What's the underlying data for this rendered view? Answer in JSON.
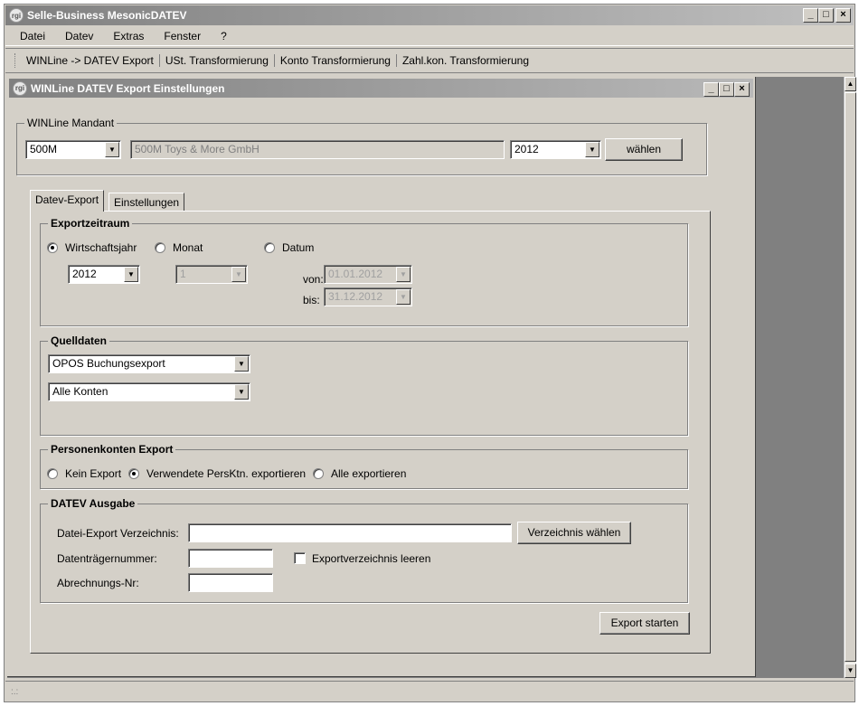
{
  "app": {
    "title": "Selle-Business MesonicDATEV",
    "icon_text": "rgi",
    "controls": {
      "minimize": "_",
      "maximize": "□",
      "close": "×"
    }
  },
  "menu": [
    "Datei",
    "Datev",
    "Extras",
    "Fenster",
    "?"
  ],
  "toolbar": [
    "WINLine -> DATEV Export",
    "USt. Transformierung",
    "Konto Transformierung",
    "Zahl.kon. Transformierung"
  ],
  "dialog": {
    "title": "WINLine DATEV Export Einstellungen",
    "mandant": {
      "legend": "WINLine Mandant",
      "code": "500M",
      "name": "500M Toys & More GmbH",
      "year": "2012",
      "select_button": "wählen"
    },
    "tabs": [
      "Datev-Export",
      "Einstellungen"
    ],
    "exportzeitraum": {
      "legend": "Exportzeitraum",
      "radio_wirtschaftsjahr": "Wirtschaftsjahr",
      "radio_monat": "Monat",
      "radio_datum": "Datum",
      "year": "2012",
      "month": "1",
      "von_label": "von:",
      "bis_label": "bis:",
      "von": "01.01.2012",
      "bis": "31.12.2012"
    },
    "quelldaten": {
      "legend": "Quelldaten",
      "source": "OPOS Buchungsexport",
      "accounts": "Alle Konten"
    },
    "personenkonten": {
      "legend": "Personenkonten Export",
      "kein": "Kein Export",
      "verwendete": "Verwendete PersKtn. exportieren",
      "alle": "Alle exportieren"
    },
    "ausgabe": {
      "legend": "DATEV Ausgabe",
      "dir_label": "Datei-Export Verzeichnis:",
      "dir_value": "",
      "dir_button": "Verzeichnis wählen",
      "datentraeger_label": "Datenträgernummer:",
      "datentraeger_value": "",
      "clear_dir_label": "Exportverzeichnis leeren",
      "abrechnung_label": "Abrechnungs-Nr:",
      "abrechnung_value": ""
    },
    "start_button": "Export starten"
  },
  "status": ":.:"
}
